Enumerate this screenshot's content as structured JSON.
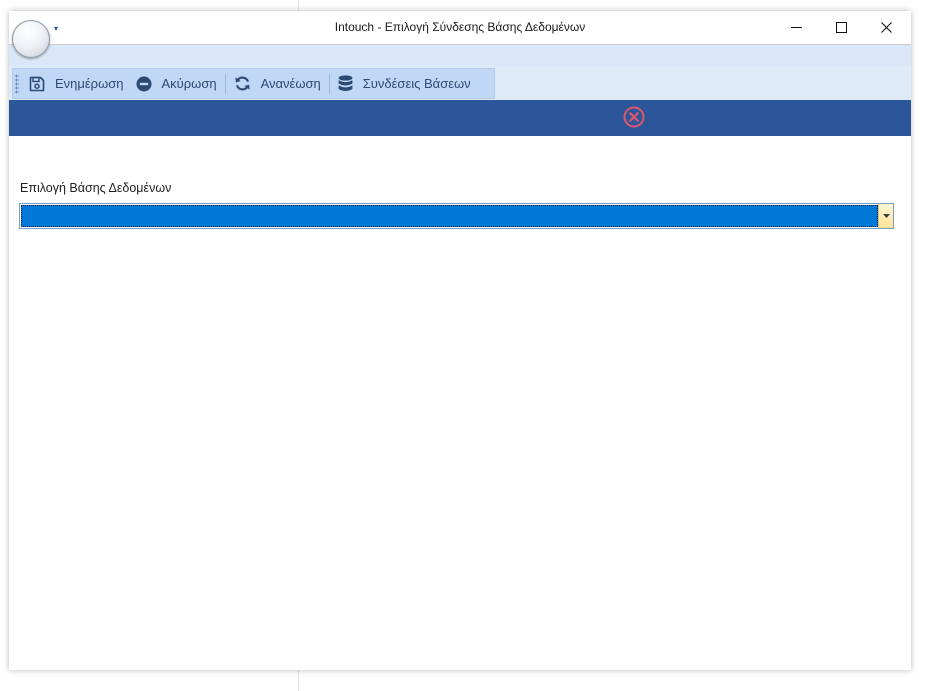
{
  "window": {
    "title": "Intouch - Επιλογή Σύνδεσης Βάσης Δεδομένων",
    "controls": {
      "minimize": "minimize-icon",
      "maximize": "maximize-icon",
      "close": "close-icon"
    }
  },
  "toolbar": {
    "items": [
      {
        "label": "Ενημέρωση",
        "icon": "save-icon"
      },
      {
        "label": "Ακύρωση",
        "icon": "cancel-icon"
      },
      {
        "label": "Ανανέωση",
        "icon": "refresh-icon"
      },
      {
        "label": "Συνδέσεις Βάσεων",
        "icon": "database-icon"
      }
    ]
  },
  "banner": {
    "icon": "close-circle-icon",
    "icon_color": "#e0566c"
  },
  "form": {
    "database_label": "Επιλογή Βάσης Δεδομένων",
    "database_value": ""
  },
  "colors": {
    "accent": "#2b579a",
    "selection": "#0078d7",
    "toolbar": "#c0d8f6",
    "icon": "#2d4a74"
  }
}
